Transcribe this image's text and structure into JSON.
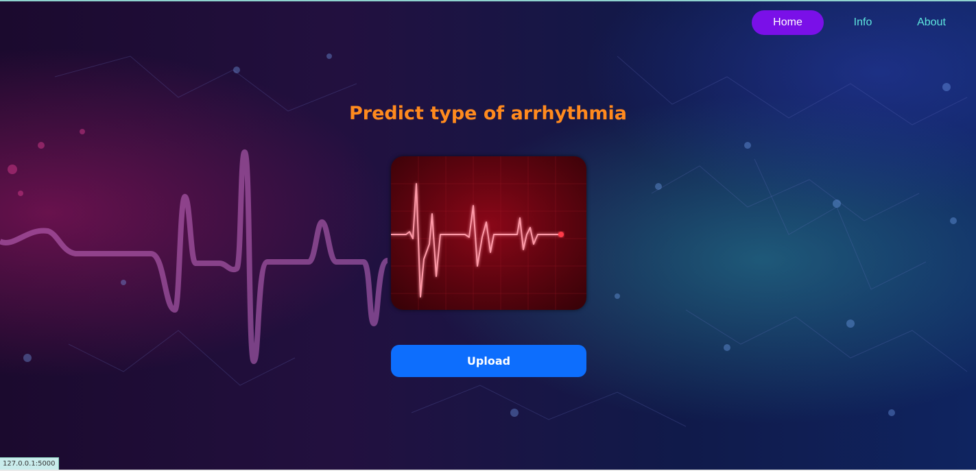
{
  "nav": {
    "items": [
      {
        "label": "Home",
        "active": true
      },
      {
        "label": "Info",
        "active": false
      },
      {
        "label": "About",
        "active": false
      }
    ]
  },
  "main": {
    "title": "Predict type of arrhythmia",
    "upload_label": "Upload"
  },
  "status_bar": {
    "url": "127.0.0.1:5000"
  },
  "colors": {
    "title": "#ff8a1e",
    "nav_text": "#5ee7df",
    "nav_active_bg": "#7a10e8",
    "upload_bg": "#0d6efd"
  }
}
